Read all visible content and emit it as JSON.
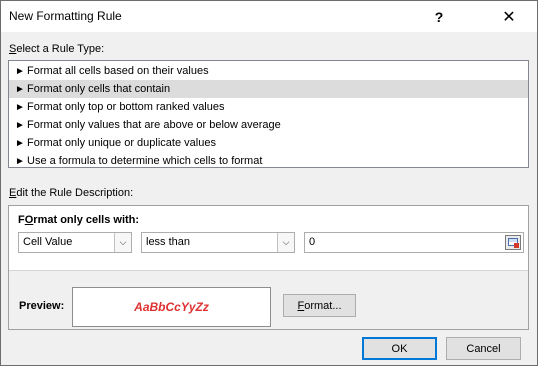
{
  "window": {
    "title": "New Formatting Rule",
    "help_glyph": "?",
    "close_glyph": "✕"
  },
  "rule_type": {
    "label_access": "S",
    "label_rest": "elect a Rule Type:",
    "items": [
      {
        "label": "Format all cells based on their values",
        "selected": false
      },
      {
        "label": "Format only cells that contain",
        "selected": true
      },
      {
        "label": "Format only top or bottom ranked values",
        "selected": false
      },
      {
        "label": "Format only values that are above or below average",
        "selected": false
      },
      {
        "label": "Format only unique or duplicate values",
        "selected": false
      },
      {
        "label": "Use a formula to determine which cells to format",
        "selected": false
      }
    ],
    "bullet_glyph": "►"
  },
  "description": {
    "label_access": "E",
    "label_rest": "dit the Rule Description:",
    "format_only_access": "O",
    "format_only_pre": "F",
    "format_only_rest": "rmat only cells with:",
    "condition_type": "Cell Value",
    "operator": "less than",
    "value": "0",
    "preview_label": "Preview:",
    "preview_sample": "AaBbCcYyZz",
    "format_button_access": "F",
    "format_button_rest": "ormat..."
  },
  "buttons": {
    "ok": "OK",
    "cancel": "Cancel"
  },
  "colors": {
    "preview_text": "#e03030",
    "selected_row": "#dcdcdc",
    "default_button_border": "#0078d7"
  }
}
